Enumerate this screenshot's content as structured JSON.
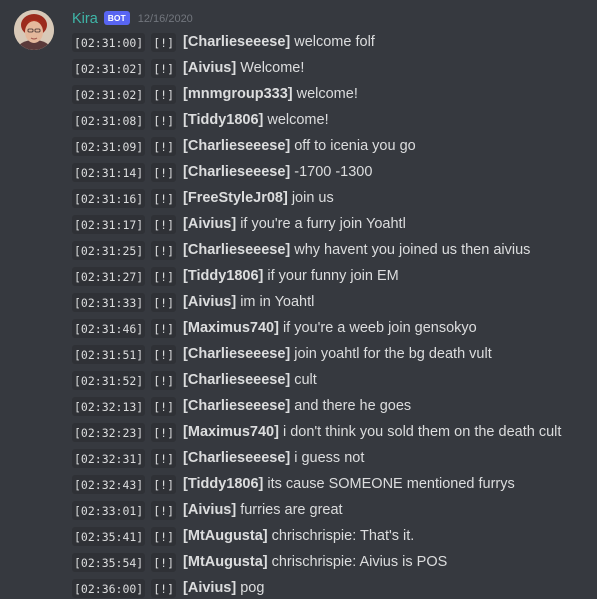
{
  "message": {
    "author": "Kira",
    "bot_tag": "BOT",
    "timestamp": "12/16/2020",
    "lines": [
      {
        "time": "[02:31:00]",
        "flag": "[!]",
        "name": "[Charlieseeese]",
        "text": "welcome folf"
      },
      {
        "time": "[02:31:02]",
        "flag": "[!]",
        "name": "[Aivius]",
        "text": "Welcome!"
      },
      {
        "time": "[02:31:02]",
        "flag": "[!]",
        "name": "[mnmgroup333]",
        "text": "welcome!"
      },
      {
        "time": "[02:31:08]",
        "flag": "[!]",
        "name": "[Tiddy1806]",
        "text": "welcome!"
      },
      {
        "time": "[02:31:09]",
        "flag": "[!]",
        "name": "[Charlieseeese]",
        "text": "off to icenia you go"
      },
      {
        "time": "[02:31:14]",
        "flag": "[!]",
        "name": "[Charlieseeese]",
        "text": "-1700 -1300"
      },
      {
        "time": "[02:31:16]",
        "flag": "[!]",
        "name": "[FreeStyleJr08]",
        "text": "join us"
      },
      {
        "time": "[02:31:17]",
        "flag": "[!]",
        "name": "[Aivius]",
        "text": "if you're a furry join Yoahtl"
      },
      {
        "time": "[02:31:25]",
        "flag": "[!]",
        "name": "[Charlieseeese]",
        "text": "why havent you joined us then aivius"
      },
      {
        "time": "[02:31:27]",
        "flag": "[!]",
        "name": "[Tiddy1806]",
        "text": "if your funny join EM"
      },
      {
        "time": "[02:31:33]",
        "flag": "[!]",
        "name": "[Aivius]",
        "text": "im in Yoahtl"
      },
      {
        "time": "[02:31:46]",
        "flag": "[!]",
        "name": "[Maximus740]",
        "text": "if you're a weeb join gensokyo"
      },
      {
        "time": "[02:31:51]",
        "flag": "[!]",
        "name": "[Charlieseeese]",
        "text": "join yoahtl for the bg death vult"
      },
      {
        "time": "[02:31:52]",
        "flag": "[!]",
        "name": "[Charlieseeese]",
        "text": "cult"
      },
      {
        "time": "[02:32:13]",
        "flag": "[!]",
        "name": "[Charlieseeese]",
        "text": "and there he goes"
      },
      {
        "time": "[02:32:23]",
        "flag": "[!]",
        "name": "[Maximus740]",
        "text": "i don't think you sold them on the death cult"
      },
      {
        "time": "[02:32:31]",
        "flag": "[!]",
        "name": "[Charlieseeese]",
        "text": "i guess not"
      },
      {
        "time": "[02:32:43]",
        "flag": "[!]",
        "name": "[Tiddy1806]",
        "text": "its cause SOMEONE mentioned furrys"
      },
      {
        "time": "[02:33:01]",
        "flag": "[!]",
        "name": "[Aivius]",
        "text": "furries are great"
      },
      {
        "time": "[02:35:41]",
        "flag": "[!]",
        "name": "[MtAugusta]",
        "text": "chrischrispie: That's it."
      },
      {
        "time": "[02:35:54]",
        "flag": "[!]",
        "name": "[MtAugusta]",
        "text": "chrischrispie: Aivius is POS"
      },
      {
        "time": "[02:36:00]",
        "flag": "[!]",
        "name": "[Aivius]",
        "text": "pog"
      }
    ]
  },
  "colors": {
    "background": "#36393f",
    "username": "#3fb6a8",
    "bot_tag": "#5865f2",
    "timestamp": "#72767d",
    "code_background": "#2f3136",
    "text": "#dcddde"
  },
  "icons": {
    "avatar": "user-avatar-photo"
  }
}
